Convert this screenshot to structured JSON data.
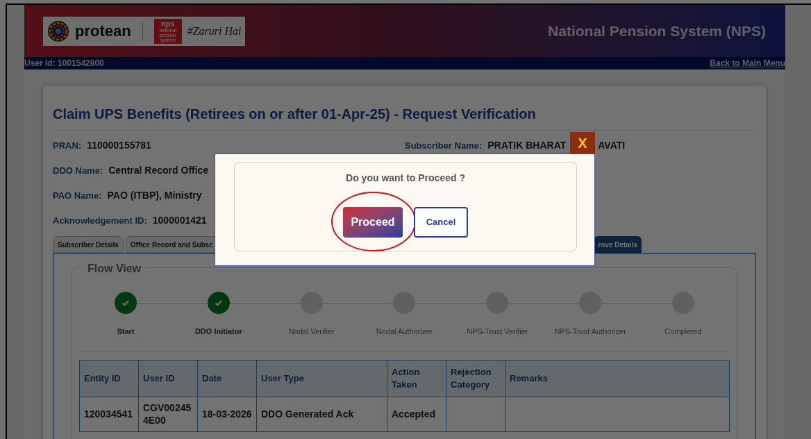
{
  "header": {
    "logo_text": "protean",
    "badge_title": "nps",
    "badge_sub": "national pension system",
    "tagline": "#Zaruri Hai",
    "title": "National Pension System (NPS)"
  },
  "user_bar": {
    "user_id": "User Id: 1001542800",
    "back_link": "Back to Main Menu"
  },
  "page_title": "Claim UPS Benefits (Retirees on or after 01-Apr-25) - Request Verification",
  "fields": [
    {
      "label": "PRAN:",
      "value": "110000155781"
    },
    {
      "label": "Subscriber Name:",
      "value": "PRATIK BHARAT",
      "value_tail": "AVATI"
    },
    {
      "label": "DDO Name:",
      "value": "Central Record Office"
    },
    {
      "label": "PAO Name:",
      "value": "PAO (ITBP), Ministry"
    },
    {
      "label": "Acknowledgement ID:",
      "value": "1000001421"
    }
  ],
  "tabs": [
    {
      "label": "Subscriber Details",
      "selected": false
    },
    {
      "label": "Office Record and Subsc",
      "selected": false
    },
    {
      "label": "rove Details",
      "selected": true
    }
  ],
  "flow_view": {
    "title": "Flow View",
    "steps": [
      {
        "label": "Start",
        "done": true
      },
      {
        "label": "DDO Initiator",
        "done": true
      },
      {
        "label": "Nodal Verifier",
        "done": false
      },
      {
        "label": "Nodal Authorizer",
        "done": false
      },
      {
        "label": "NPS-Trust Verifier",
        "done": false
      },
      {
        "label": "NPS-Trust Authorizer",
        "done": false
      },
      {
        "label": "Completed",
        "done": false
      }
    ]
  },
  "table": {
    "columns": [
      "Entity ID",
      "User ID",
      "Date",
      "User Type",
      "Action Taken",
      "Rejection Category",
      "Remarks"
    ],
    "rows": [
      [
        "120034541",
        "CGV00245 4E00",
        "18-03-2026",
        "DDO Generated Ack",
        "Accepted",
        "",
        ""
      ]
    ]
  },
  "dialog": {
    "close": "X",
    "message": "Do you want to Proceed ?",
    "buttons": [
      {
        "label": "Proceed",
        "kind": "primary",
        "circled": true
      },
      {
        "label": "Cancel",
        "kind": "secondary",
        "circled": false
      }
    ]
  }
}
